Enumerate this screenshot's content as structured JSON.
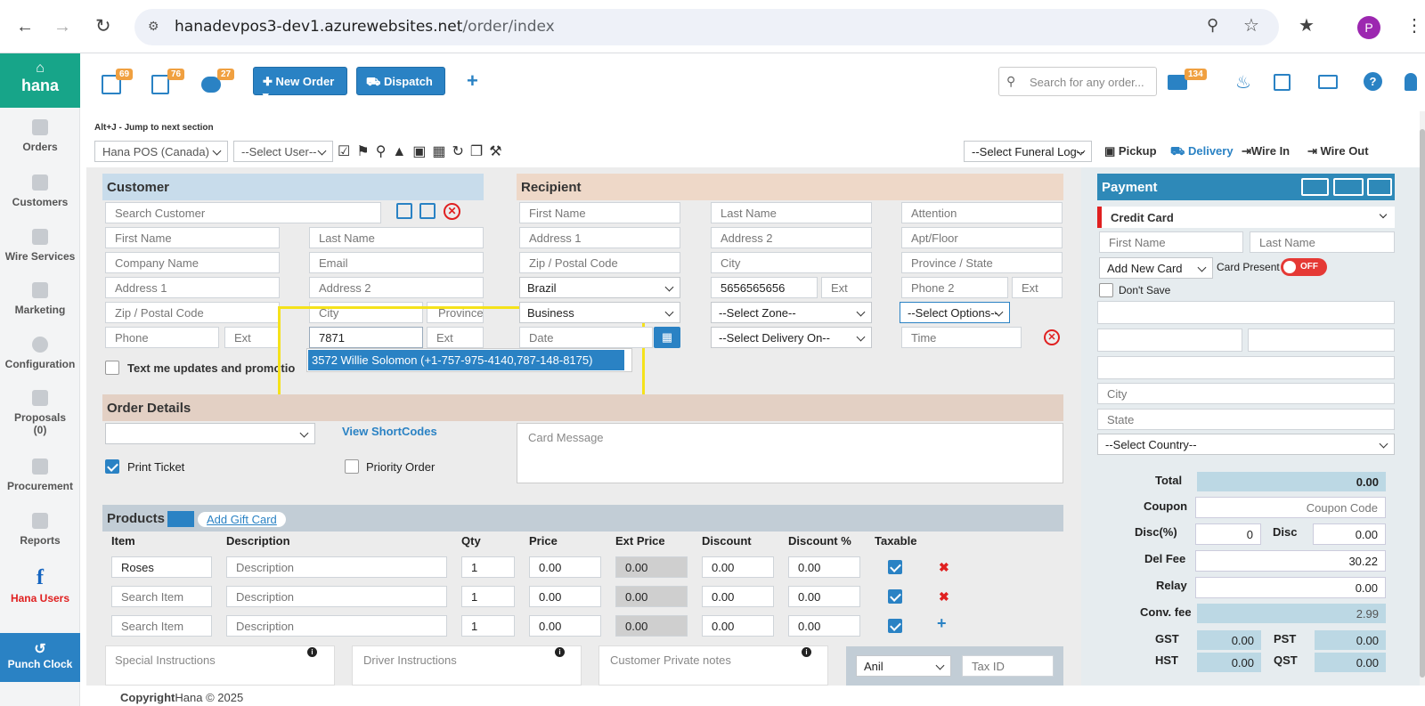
{
  "browser": {
    "url_host": "hanadevpos3-dev1.azurewebsites.net",
    "url_path": "/order/index",
    "profile_initial": "P"
  },
  "sidebar": {
    "logo": "hana",
    "items": [
      {
        "label": "Orders",
        "icon": "orders-icon"
      },
      {
        "label": "Customers",
        "icon": "customers-icon"
      },
      {
        "label": "Wire Services",
        "icon": "wire-services-icon"
      },
      {
        "label": "Marketing",
        "icon": "marketing-icon"
      },
      {
        "label": "Configuration",
        "icon": "gear-icon"
      },
      {
        "label": "Proposals",
        "icon": "proposals-icon"
      },
      {
        "label": "(0)",
        "icon": ""
      },
      {
        "label": "Procurement",
        "icon": "procurement-icon"
      },
      {
        "label": "Reports",
        "icon": "reports-icon"
      },
      {
        "label": "Hana Users",
        "icon": "facebook-icon"
      }
    ],
    "punch_clock": "Punch Clock"
  },
  "topbar": {
    "badge1": "69",
    "badge2": "76",
    "badge3": "27",
    "new_order": "New Order",
    "dispatch": "Dispatch",
    "search_placeholder": "Search for any order...",
    "mail_badge": "134"
  },
  "toolbar": {
    "hint": "Alt+J - Jump to next section",
    "store_select": "Hana POS (Canada)",
    "user_select": "--Select User--",
    "funeral_select": "--Select Funeral Log--",
    "pickup": "Pickup",
    "delivery": "Delivery",
    "wire_in": "Wire In",
    "wire_out": "Wire Out"
  },
  "customer": {
    "title": "Customer",
    "search": "Search Customer",
    "first_name": "First Name",
    "last_name": "Last Name",
    "company": "Company Name",
    "email": "Email",
    "address1": "Address 1",
    "address2": "Address 2",
    "zip": "Zip / Postal Code",
    "city": "City",
    "province": "Province",
    "phone": "Phone",
    "ext": "Ext",
    "phone2_value": "7871",
    "ext2": "Ext",
    "text_me": "Text me updates and promotio",
    "suggestion": "3572 Willie Solomon (+1-757-975-4140,787-148-8175)"
  },
  "recipient": {
    "title": "Recipient",
    "first_name": "First Name",
    "last_name": "Last Name",
    "attention": "Attention",
    "address1": "Address 1",
    "address2": "Address 2",
    "apt": "Apt/Floor",
    "zip": "Zip / Postal Code",
    "city": "City",
    "province": "Province / State",
    "country": "Brazil",
    "phone": "5656565656",
    "ext": "Ext",
    "phone2": "Phone 2",
    "ext2": "Ext",
    "location_type": "Business",
    "zone": "--Select Zone--",
    "options": "--Select Options--",
    "date": "Date",
    "delivery_on": "--Select Delivery On--",
    "time": "Time"
  },
  "order_details": {
    "title": "Order Details",
    "view_shortcodes": "View ShortCodes",
    "print_ticket": "Print Ticket",
    "priority_order": "Priority Order",
    "card_message": "Card Message"
  },
  "products": {
    "title": "Products",
    "add_gift_card": "Add Gift Card",
    "headers": [
      "Item",
      "Description",
      "Qty",
      "Price",
      "Ext Price",
      "Discount",
      "Discount %",
      "Taxable"
    ],
    "rows": [
      {
        "item": "Roses",
        "description": "Description",
        "qty": "1",
        "price": "0.00",
        "ext": "0.00",
        "discount": "0.00",
        "discount_pct": "0.00"
      },
      {
        "item": "Search Item",
        "description": "Description",
        "qty": "1",
        "price": "0.00",
        "ext": "0.00",
        "discount": "0.00",
        "discount_pct": "0.00"
      },
      {
        "item": "Search Item",
        "description": "Description",
        "qty": "1",
        "price": "0.00",
        "ext": "0.00",
        "discount": "0.00",
        "discount_pct": "0.00"
      }
    ],
    "special_instructions": "Special Instructions",
    "driver_instructions": "Driver Instructions",
    "private_notes": "Customer Private notes",
    "employee": "Anil",
    "tax_id": "Tax ID"
  },
  "payment": {
    "title": "Payment",
    "method": "Credit Card",
    "first_name": "First Name",
    "last_name": "Last Name",
    "add_card": "Add New Card",
    "card_present": "Card Present",
    "toggle": "OFF",
    "dont_save": "Don't Save",
    "city": "City",
    "state": "State",
    "country": "--Select Country--",
    "total_label": "Total",
    "total": "0.00",
    "coupon_label": "Coupon",
    "coupon_placeholder": "Coupon Code",
    "disc_pct_label": "Disc(%)",
    "disc_pct": "0",
    "disc_label": "Disc",
    "disc": "0.00",
    "del_fee_label": "Del Fee",
    "del_fee": "30.22",
    "relay_label": "Relay",
    "relay": "0.00",
    "conv_label": "Conv. fee",
    "conv": "2.99",
    "gst_label": "GST",
    "gst": "0.00",
    "pst_label": "PST",
    "pst": "0.00",
    "hst_label": "HST",
    "hst": "0.00",
    "qst_label": "QST",
    "qst": "0.00"
  },
  "footer": {
    "copyright_bold": "Copyright",
    "copyright_rest": "Hana © 2025"
  },
  "colors": {
    "brand": "#17a589",
    "primary": "#2a82c4",
    "highlight": "#f5e21b"
  }
}
